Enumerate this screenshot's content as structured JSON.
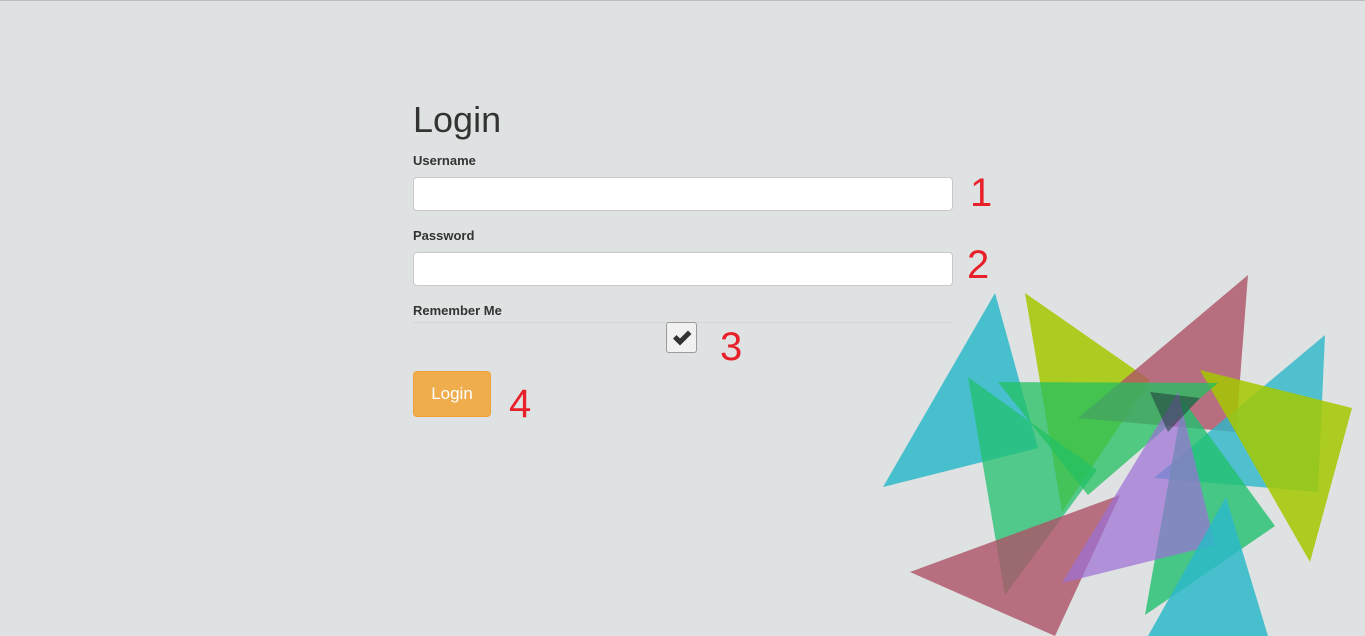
{
  "login_form": {
    "title": "Login",
    "username_label": "Username",
    "username_value": "",
    "password_label": "Password",
    "password_value": "",
    "remember_label": "Remember Me",
    "remember_checked": true,
    "submit_label": "Login"
  },
  "annotations": [
    "1",
    "2",
    "3",
    "4"
  ],
  "colors": {
    "background": "#dfe2e2",
    "button": "#f0ad4e",
    "annotation": "#e8202a",
    "decor": [
      "#2db8c9",
      "#a5c800",
      "#ad5266",
      "#20c06e",
      "#9b6fd6",
      "#33ad19"
    ]
  },
  "icons": {
    "checkbox": "checkmark-icon"
  }
}
